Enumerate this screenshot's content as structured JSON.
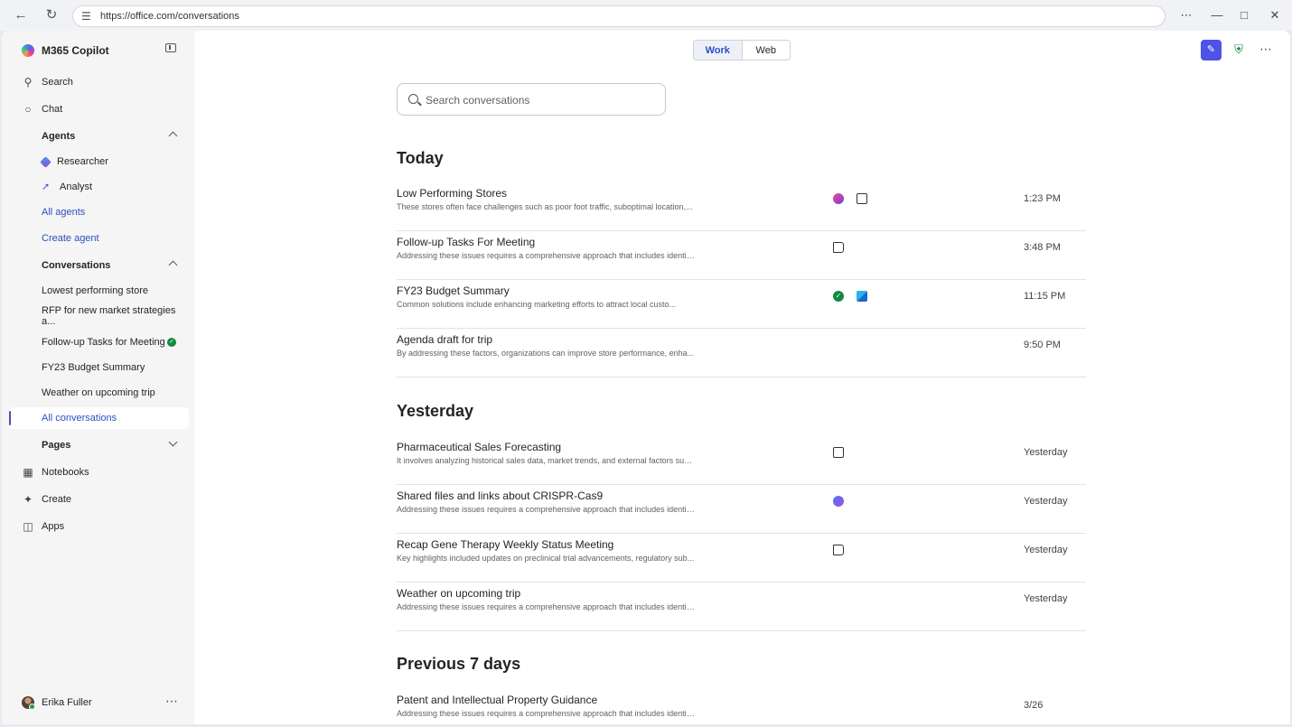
{
  "browser": {
    "url": "https://office.com/conversations"
  },
  "sidebar": {
    "brand": "M365 Copilot",
    "search_label": "Search",
    "chat_label": "Chat",
    "agents": {
      "header": "Agents",
      "items": [
        "Researcher",
        "Analyst"
      ],
      "all_agents": "All agents",
      "create_agent": "Create agent"
    },
    "conversations": {
      "header": "Conversations",
      "items": [
        "Lowest performing store",
        "RFP for new market strategies a...",
        "Follow-up Tasks for Meeting",
        "FY23 Budget Summary",
        "Weather on upcoming trip"
      ],
      "all_conversations": "All conversations"
    },
    "pages_label": "Pages",
    "notebooks_label": "Notebooks",
    "create_label": "Create",
    "apps_label": "Apps",
    "user_name": "Erika Fuller"
  },
  "toggle": {
    "work": "Work",
    "web": "Web"
  },
  "search": {
    "placeholder": "Search conversations"
  },
  "groups": [
    {
      "title": "Today",
      "rows": [
        {
          "title": "Low Performing Stores",
          "desc": "These stores often face challenges such as poor foot traffic, suboptimal location,...",
          "time": "1:23 PM",
          "icons": [
            "loop-icon",
            "page-icon"
          ]
        },
        {
          "title": "Follow-up Tasks For Meeting",
          "desc": "Addressing these issues requires a comprehensive approach that includes identif...",
          "time": "3:48 PM",
          "icons": [
            "book-icon"
          ]
        },
        {
          "title": "FY23 Budget Summary",
          "desc": "Common solutions include enhancing marketing efforts to attract local custo...",
          "time": "11:15 PM",
          "icons": [
            "check-icon",
            "cube-icon"
          ]
        },
        {
          "title": "Agenda draft for trip",
          "desc": "By addressing these factors, organizations can improve store performance, enha...",
          "time": "9:50 PM",
          "icons": []
        }
      ]
    },
    {
      "title": "Yesterday",
      "rows": [
        {
          "title": "Pharmaceutical Sales Forecasting",
          "desc": "It involves analyzing historical sales data, market trends, and external factors suc...",
          "time": "Yesterday",
          "icons": [
            "page-icon"
          ]
        },
        {
          "title": "Shared files and links about CRISPR-Cas9",
          "desc": "Addressing these issues requires a comprehensive approach that includes identif...",
          "time": "Yesterday",
          "icons": [
            "loop2-icon"
          ]
        },
        {
          "title": "Recap Gene Therapy Weekly Status Meeting",
          "desc": "Key highlights included updates on preclinical trial advancements, regulatory sub...",
          "time": "Yesterday",
          "icons": [
            "book-icon"
          ]
        },
        {
          "title": "Weather on upcoming trip",
          "desc": "Addressing these issues requires a comprehensive approach that includes identif...",
          "time": "Yesterday",
          "icons": []
        }
      ]
    },
    {
      "title": "Previous 7 days",
      "rows": [
        {
          "title": "Patent and Intellectual Property Guidance",
          "desc": "Addressing these issues requires a comprehensive approach that includes identif...",
          "time": "3/26",
          "icons": []
        }
      ]
    }
  ]
}
